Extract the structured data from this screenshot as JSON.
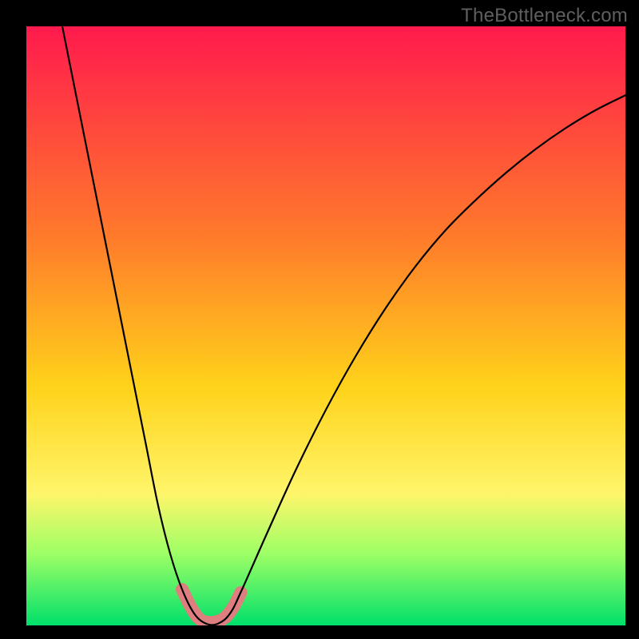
{
  "watermark": "TheBottleneck.com",
  "chart_data": {
    "type": "line",
    "title": "",
    "xlabel": "",
    "ylabel": "",
    "xlim": [
      0,
      100
    ],
    "ylim": [
      0,
      100
    ],
    "background_gradient": {
      "stops": [
        {
          "offset": 0.0,
          "color": "#ff1a4d"
        },
        {
          "offset": 0.35,
          "color": "#ff7a2b"
        },
        {
          "offset": 0.6,
          "color": "#ffd21a"
        },
        {
          "offset": 0.78,
          "color": "#fff56a"
        },
        {
          "offset": 0.88,
          "color": "#9eff66"
        },
        {
          "offset": 1.0,
          "color": "#00e06a"
        }
      ]
    },
    "series": [
      {
        "name": "bottleneck-curve",
        "stroke": "#000000",
        "stroke_width": 2.2,
        "points": [
          {
            "x": 6.0,
            "y": 100.0
          },
          {
            "x": 8.0,
            "y": 90.0
          },
          {
            "x": 10.0,
            "y": 80.0
          },
          {
            "x": 12.0,
            "y": 70.0
          },
          {
            "x": 14.0,
            "y": 60.0
          },
          {
            "x": 16.0,
            "y": 50.0
          },
          {
            "x": 18.0,
            "y": 40.0
          },
          {
            "x": 20.0,
            "y": 30.0
          },
          {
            "x": 22.0,
            "y": 20.0
          },
          {
            "x": 24.0,
            "y": 12.0
          },
          {
            "x": 26.0,
            "y": 6.0
          },
          {
            "x": 28.0,
            "y": 2.0
          },
          {
            "x": 30.0,
            "y": 0.3
          },
          {
            "x": 32.0,
            "y": 0.3
          },
          {
            "x": 34.0,
            "y": 2.0
          },
          {
            "x": 36.0,
            "y": 6.0
          },
          {
            "x": 40.0,
            "y": 15.0
          },
          {
            "x": 45.0,
            "y": 26.0
          },
          {
            "x": 50.0,
            "y": 36.0
          },
          {
            "x": 55.0,
            "y": 45.0
          },
          {
            "x": 60.0,
            "y": 53.0
          },
          {
            "x": 65.0,
            "y": 60.0
          },
          {
            "x": 70.0,
            "y": 66.0
          },
          {
            "x": 75.0,
            "y": 71.0
          },
          {
            "x": 80.0,
            "y": 75.5
          },
          {
            "x": 85.0,
            "y": 79.5
          },
          {
            "x": 90.0,
            "y": 83.0
          },
          {
            "x": 95.0,
            "y": 86.0
          },
          {
            "x": 100.0,
            "y": 88.5
          }
        ]
      }
    ],
    "markers": [
      {
        "name": "highlight-band",
        "stroke": "#de7e7e",
        "stroke_width": 16,
        "cap": "round",
        "points": [
          {
            "x": 26.0,
            "y": 6.0
          },
          {
            "x": 27.5,
            "y": 3.0
          },
          {
            "x": 29.0,
            "y": 1.0
          },
          {
            "x": 31.0,
            "y": 0.5
          },
          {
            "x": 33.0,
            "y": 1.2
          },
          {
            "x": 34.5,
            "y": 3.0
          },
          {
            "x": 35.8,
            "y": 5.5
          }
        ]
      }
    ]
  }
}
